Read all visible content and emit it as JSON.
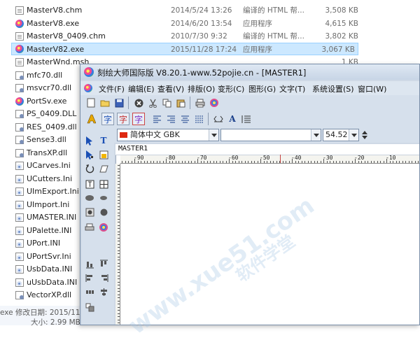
{
  "explorer": {
    "files": [
      {
        "name": "MasterV8.chm",
        "date": "2014/5/24 13:26",
        "type": "编译的 HTML 帮...",
        "size": "3,508 KB",
        "icon": "doc-icon"
      },
      {
        "name": "MasterV8.exe",
        "date": "2014/6/20 13:54",
        "type": "应用程序",
        "size": "4,615 KB",
        "icon": "exe-icon"
      },
      {
        "name": "MasterV8_0409.chm",
        "date": "2010/7/30 9:32",
        "type": "编译的 HTML 帮...",
        "size": "3,802 KB",
        "icon": "doc-icon"
      },
      {
        "name": "MasterV82.exe",
        "date": "2015/11/28 17:24",
        "type": "应用程序",
        "size": "3,067 KB",
        "icon": "exe-icon",
        "selected": true
      },
      {
        "name": "MasterWnd.msh",
        "date": "",
        "type": "",
        "size": "1 KB",
        "icon": "doc-icon"
      },
      {
        "name": "mfc70.dll",
        "icon": "dll-icon"
      },
      {
        "name": "msvcr70.dll",
        "icon": "dll-icon"
      },
      {
        "name": "PortSv.exe",
        "icon": "exe-icon"
      },
      {
        "name": "PS_0409.DLL",
        "icon": "dll-icon"
      },
      {
        "name": "RES_0409.dll",
        "icon": "dll-icon"
      },
      {
        "name": "Sense3.dll",
        "icon": "dll-icon"
      },
      {
        "name": "TransXP.dll",
        "icon": "dll-icon"
      },
      {
        "name": "UCarves.Ini",
        "icon": "ini-icon"
      },
      {
        "name": "UCutters.Ini",
        "icon": "ini-icon"
      },
      {
        "name": "UImExport.Ini",
        "icon": "ini-icon"
      },
      {
        "name": "UImport.Ini",
        "icon": "ini-icon"
      },
      {
        "name": "UMASTER.INI",
        "icon": "ini-icon"
      },
      {
        "name": "UPalette.INI",
        "icon": "ini-icon"
      },
      {
        "name": "UPort.INI",
        "icon": "ini-icon"
      },
      {
        "name": "UPortSvr.Ini",
        "icon": "ini-icon"
      },
      {
        "name": "UsbData.INI",
        "icon": "ini-icon"
      },
      {
        "name": "uUsbData.INI",
        "icon": "ini-icon"
      },
      {
        "name": "VectorXP.dll",
        "icon": "dll-icon"
      }
    ],
    "details": {
      "line1": "exe  修改日期: 2015/11",
      "line2": "大小: 2.99 MB"
    }
  },
  "app": {
    "title": "刻绘大师国际版 V8.20.1-www.52pojie.cn - [MASTER1]",
    "menus": [
      "文件(F)",
      "编辑(E)",
      "查看(V)",
      "排版(O)",
      "变形(C)",
      "图形(G)",
      "文字(T)",
      "系统设置(S)",
      "窗口(W)"
    ],
    "font_select": "简体中文 GBK",
    "size_select": "54.52",
    "doc_tab": "MASTER1",
    "ruler_labels": [
      "-90",
      "-80",
      "-70",
      "-60",
      "-50",
      "-40",
      "-30",
      "-20",
      "-10"
    ],
    "text_tools": [
      "字",
      "字",
      "字"
    ],
    "colors": {
      "accent": "#cce8ff",
      "ruler_origin": "#c44444"
    }
  }
}
